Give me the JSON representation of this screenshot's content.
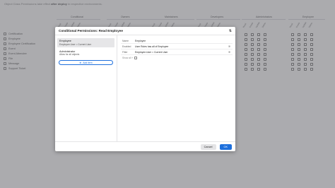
{
  "notice": {
    "prefix": "Object Class Permissions take effect",
    "bold": "after deploy",
    "suffix": "in respective environments."
  },
  "groups": [
    "Conditional",
    "Owners",
    "Maintainers",
    "Developers",
    "Administrators",
    "Employee"
  ],
  "column_labels": [
    "Read",
    "Create",
    "Update",
    "Delete"
  ],
  "rows": [
    {
      "label": "Certification",
      "icon": "table-icon"
    },
    {
      "label": "Employee",
      "icon": "table-icon"
    },
    {
      "label": "Employee Certification",
      "icon": "table-icon"
    },
    {
      "label": "Event",
      "icon": "table-icon"
    },
    {
      "label": "Event Attendee",
      "icon": "table-icon"
    },
    {
      "label": "File",
      "icon": "table-icon"
    },
    {
      "label": "Message",
      "icon": "table-icon"
    },
    {
      "label": "Support Ticket",
      "icon": "table-icon"
    }
  ],
  "modal": {
    "title": "Conditional Permissions: Read Employee",
    "sort_icon": "sort-icon",
    "conditions": [
      {
        "title": "Employee",
        "subtitle": "Employee.User = Current User",
        "active": true
      },
      {
        "title": "Administrator",
        "subtitle": "Allow for all objects",
        "active": false
      }
    ],
    "add_button": "Add item",
    "form": {
      "name_label": "Name",
      "name_value": "Employee",
      "enabled_label": "Enabled",
      "enabled_value": "User Roles has all of Employee",
      "filter_label": "Filter",
      "filter_value": "Employee.User = Current User",
      "show_all_label": "Show all +"
    },
    "cancel": "Cancel",
    "ok": "OK"
  }
}
